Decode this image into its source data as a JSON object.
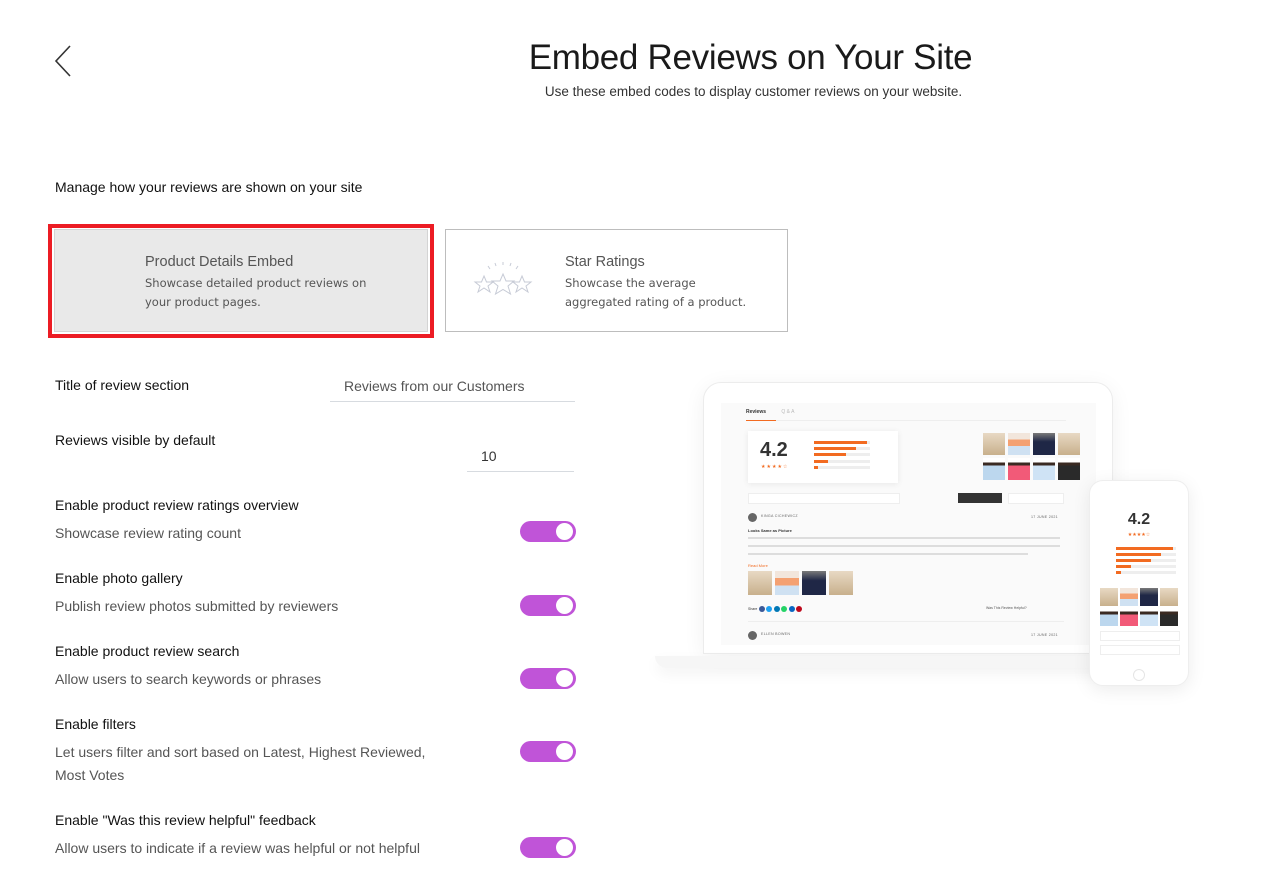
{
  "header": {
    "back_icon": "chevron-left-icon",
    "title": "Embed Reviews on Your Site",
    "subtitle": "Use these embed codes to display customer reviews on your website."
  },
  "section_heading": "Manage how your reviews are shown on your site",
  "embed_types": [
    {
      "title": "Product Details Embed",
      "description": "Showcase detailed product reviews on your product pages.",
      "selected": true
    },
    {
      "title": "Star Ratings",
      "description": "Showcase the average aggregated rating of a product.",
      "icon": "stars-icon",
      "selected": false
    }
  ],
  "fields": {
    "title_label": "Title of review section",
    "title_value": "Reviews from our Customers",
    "count_label": "Reviews visible by default",
    "count_value": "10"
  },
  "options": [
    {
      "title": "Enable product review ratings overview",
      "description": "Showcase review rating count",
      "enabled": true
    },
    {
      "title": "Enable photo gallery",
      "description": "Publish review photos submitted by reviewers",
      "enabled": true
    },
    {
      "title": "Enable product review search",
      "description": "Allow users to search keywords or phrases",
      "enabled": true
    },
    {
      "title": "Enable filters",
      "description": "Let users filter and sort based on Latest, Highest Reviewed, Most Votes",
      "enabled": true
    },
    {
      "title": "Enable \"Was this review helpful\" feedback",
      "description": "Allow users to indicate if a review was helpful or not helpful",
      "enabled": true
    }
  ],
  "colors": {
    "toggle_on": "#c054d8",
    "highlight": "#ec1c24",
    "preview_accent": "#f26b21"
  },
  "preview": {
    "tabs": [
      "Reviews",
      "Q & A"
    ],
    "average_rating": "4.2",
    "stars": "★★★★☆",
    "rating_distribution_fraction": [
      0.95,
      0.75,
      0.58,
      0.25,
      0.08
    ],
    "reviewers": [
      {
        "name": "KINGA CICHEWICZ",
        "date": "17 JUNE 2021",
        "review_title": "Looks Same as Picture",
        "read_more": "Read More"
      },
      {
        "name": "ELLEN BOWEN",
        "date": "17 JUNE 2021"
      }
    ],
    "share_label": "Share",
    "helpful_label": "Was This Review Helpful?"
  }
}
